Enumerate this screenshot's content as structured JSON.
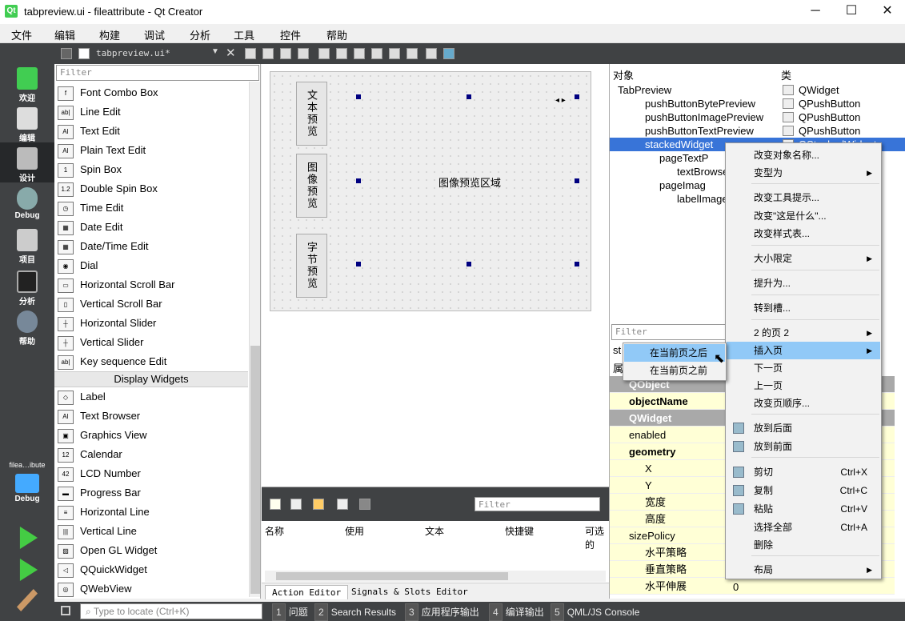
{
  "window": {
    "title": "tabpreview.ui - fileattribute - Qt Creator",
    "app_icon": "Qt",
    "minimize": "─",
    "maximize": "☐",
    "close": "✕"
  },
  "menu": [
    "文件",
    "编辑",
    "构建",
    "调试",
    "分析",
    "工具",
    "控件",
    "帮助"
  ],
  "modes": [
    {
      "label": "欢迎",
      "icon": "welcome-icon"
    },
    {
      "label": "编辑",
      "icon": "edit-icon"
    },
    {
      "label": "设计",
      "icon": "design-icon"
    },
    {
      "label": "Debug",
      "icon": "debug-icon"
    },
    {
      "label": "项目",
      "icon": "projects-icon"
    },
    {
      "label": "分析",
      "icon": "analyze-icon"
    },
    {
      "label": "帮助",
      "icon": "help-icon"
    }
  ],
  "kit": {
    "project": "filea…ibute",
    "config": "Debug"
  },
  "editor_toolbar": {
    "file": "tabpreview.ui*"
  },
  "palette": {
    "filter_placeholder": "Filter",
    "items_a": [
      {
        "label": "Font Combo Box",
        "icon": "f"
      },
      {
        "label": "Line Edit",
        "icon": "ab|"
      },
      {
        "label": "Text Edit",
        "icon": "AI"
      },
      {
        "label": "Plain Text Edit",
        "icon": "AI"
      },
      {
        "label": "Spin Box",
        "icon": "1"
      },
      {
        "label": "Double Spin Box",
        "icon": "1.2"
      },
      {
        "label": "Time Edit",
        "icon": "◷"
      },
      {
        "label": "Date Edit",
        "icon": "▦"
      },
      {
        "label": "Date/Time Edit",
        "icon": "▦"
      },
      {
        "label": "Dial",
        "icon": "◉"
      },
      {
        "label": "Horizontal Scroll Bar",
        "icon": "▭"
      },
      {
        "label": "Vertical Scroll Bar",
        "icon": "▯"
      },
      {
        "label": "Horizontal Slider",
        "icon": "┼"
      },
      {
        "label": "Vertical Slider",
        "icon": "┼"
      },
      {
        "label": "Key sequence Edit",
        "icon": "ab|"
      }
    ],
    "category": "Display Widgets",
    "items_b": [
      {
        "label": "Label",
        "icon": "◇"
      },
      {
        "label": "Text Browser",
        "icon": "AI"
      },
      {
        "label": "Graphics View",
        "icon": "▣"
      },
      {
        "label": "Calendar",
        "icon": "12"
      },
      {
        "label": "LCD Number",
        "icon": "42"
      },
      {
        "label": "Progress Bar",
        "icon": "▬"
      },
      {
        "label": "Horizontal Line",
        "icon": "≡"
      },
      {
        "label": "Vertical Line",
        "icon": "|||"
      },
      {
        "label": "Open GL Widget",
        "icon": "▨"
      },
      {
        "label": "QQuickWidget",
        "icon": "◁"
      },
      {
        "label": "QWebView",
        "icon": "◎"
      }
    ]
  },
  "form": {
    "buttons": [
      "文本预览",
      "图像预览",
      "字节预览"
    ],
    "center_label": "图像预览区域",
    "page_nav": "◂ ▸"
  },
  "action_editor": {
    "filter_placeholder": "Filter",
    "columns": [
      "名称",
      "使用",
      "文本",
      "快捷键",
      "可选的"
    ],
    "tabs": [
      "Action Editor",
      "Signals & Slots Editor"
    ]
  },
  "object_inspector": {
    "headers": [
      "对象",
      "类"
    ],
    "rows": [
      {
        "name": "TabPreview",
        "cls": "QWidget"
      },
      {
        "name": "pushButtonBytePreview",
        "cls": "QPushButton"
      },
      {
        "name": "pushButtonImagePreview",
        "cls": "QPushButton"
      },
      {
        "name": "pushButtonTextPreview",
        "cls": "QPushButton"
      },
      {
        "name": "stackedWidget",
        "cls": "QStackedWidget"
      },
      {
        "name": "pageTextP",
        "cls": ""
      },
      {
        "name": "textBrowse",
        "cls": ""
      },
      {
        "name": "pageImag",
        "cls": ""
      },
      {
        "name": "labelImage",
        "cls": ""
      }
    ]
  },
  "property_editor": {
    "filter_placeholder": "Filter",
    "object_prefix": "st",
    "header": "属",
    "rows": [
      {
        "label": "QObject",
        "type": "grp"
      },
      {
        "label": "objectName",
        "type": "bold"
      },
      {
        "label": "QWidget",
        "type": "grp"
      },
      {
        "label": "enabled",
        "type": ""
      },
      {
        "label": "geometry",
        "type": "bold"
      },
      {
        "label": "X",
        "type": "sub"
      },
      {
        "label": "Y",
        "type": "sub"
      },
      {
        "label": "宽度",
        "type": "sub"
      },
      {
        "label": "高度",
        "type": "sub"
      },
      {
        "label": "sizePolicy",
        "type": ""
      },
      {
        "label": "水平策略",
        "type": "sub"
      },
      {
        "label": "垂直策略",
        "type": "sub"
      },
      {
        "label": "水平伸展",
        "type": "sub"
      }
    ],
    "value_hstretch": "0"
  },
  "context_menu": {
    "items": [
      {
        "label": "改变对象名称...",
        "sc": "",
        "ar": ""
      },
      {
        "label": "变型为",
        "sc": "",
        "ar": "▶"
      },
      {
        "label": "改变工具提示...",
        "sc": "",
        "ar": ""
      },
      {
        "label": "改变\"这是什么\"...",
        "sc": "",
        "ar": ""
      },
      {
        "label": "改变样式表...",
        "sc": "",
        "ar": ""
      },
      {
        "label": "大小限定",
        "sc": "",
        "ar": "▶"
      },
      {
        "label": "提升为...",
        "sc": "",
        "ar": ""
      },
      {
        "label": "转到槽...",
        "sc": "",
        "ar": ""
      },
      {
        "label": "2 的页 2",
        "sc": "",
        "ar": "▶"
      },
      {
        "label": "插入页",
        "sc": "",
        "ar": "▶"
      },
      {
        "label": "下一页",
        "sc": "",
        "ar": ""
      },
      {
        "label": "上一页",
        "sc": "",
        "ar": ""
      },
      {
        "label": "改变页顺序...",
        "sc": "",
        "ar": ""
      },
      {
        "label": "放到后面",
        "sc": "",
        "ar": ""
      },
      {
        "label": "放到前面",
        "sc": "",
        "ar": ""
      },
      {
        "label": "剪切",
        "sc": "Ctrl+X",
        "ar": ""
      },
      {
        "label": "复制",
        "sc": "Ctrl+C",
        "ar": ""
      },
      {
        "label": "粘贴",
        "sc": "Ctrl+V",
        "ar": ""
      },
      {
        "label": "选择全部",
        "sc": "Ctrl+A",
        "ar": ""
      },
      {
        "label": "删除",
        "sc": "",
        "ar": ""
      },
      {
        "label": "布局",
        "sc": "",
        "ar": "▶"
      }
    ],
    "submenu": [
      "在当前页之后",
      "在当前页之前"
    ]
  },
  "statusbar": {
    "locate_placeholder": "Type to locate (Ctrl+K)",
    "panes": [
      {
        "n": "1",
        "label": "问题"
      },
      {
        "n": "2",
        "label": "Search Results"
      },
      {
        "n": "3",
        "label": "应用程序输出"
      },
      {
        "n": "4",
        "label": "编译输出"
      },
      {
        "n": "5",
        "label": "QML/JS Console"
      }
    ]
  }
}
